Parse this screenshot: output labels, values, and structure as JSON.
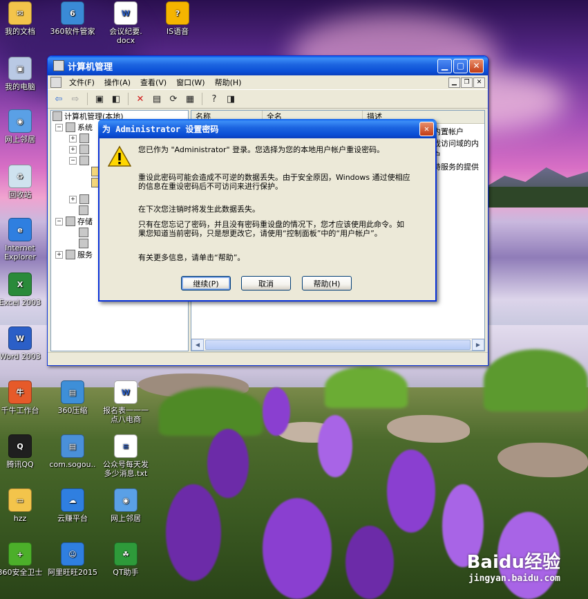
{
  "desktop": {
    "icons": [
      {
        "label": "我的文档",
        "label2": "",
        "color": "#f3c44b",
        "glyph": "✉"
      },
      {
        "label": "360软件管家",
        "label2": "",
        "color": "#3a8ad6",
        "glyph": "6"
      },
      {
        "label": "会议纪要.",
        "label2": "docx",
        "color": "#ffffff",
        "glyph": "W"
      },
      {
        "label": "IS语音",
        "label2": "",
        "color": "#f5b400",
        "glyph": "?"
      },
      {
        "label": "我的电脑",
        "label2": "",
        "color": "#b9c9e4",
        "glyph": "▣"
      },
      {
        "label": "网上邻居",
        "label2": "",
        "color": "#5aa0e6",
        "glyph": "◉"
      },
      {
        "label": "回收站",
        "label2": "",
        "color": "#cfe3ef",
        "glyph": "♻"
      },
      {
        "label": "Internet",
        "label2": "Explorer",
        "color": "#2f7fe0",
        "glyph": "e"
      },
      {
        "label": "Excel 2003",
        "label2": "",
        "color": "#2a8a3a",
        "glyph": "X"
      },
      {
        "label": "Word 2003",
        "label2": "",
        "color": "#2b5fc7",
        "glyph": "W"
      },
      {
        "label": "千牛工作台",
        "label2": "",
        "color": "#e65a2a",
        "glyph": "牛"
      },
      {
        "label": "360压缩",
        "label2": "",
        "color": "#3e8fd8",
        "glyph": "▤"
      },
      {
        "label": "报名表一一一",
        "label2": "点八电商",
        "color": "#ffffff",
        "glyph": "W"
      },
      {
        "label": "腾讯QQ",
        "label2": "",
        "color": "#1f1f1f",
        "glyph": "Q"
      },
      {
        "label": "com.sogou..",
        "label2": "",
        "color": "#4a90d9",
        "glyph": "▤"
      },
      {
        "label": "公众号每天发",
        "label2": "多少消息.txt",
        "color": "#ffffff",
        "glyph": "≡"
      },
      {
        "label": "hzz",
        "label2": "",
        "color": "#f3c44b",
        "glyph": "▭"
      },
      {
        "label": "云赚平台",
        "label2": "",
        "color": "#2f7fe0",
        "glyph": "☁"
      },
      {
        "label": "网上邻居",
        "label2": "",
        "color": "#5aa0e6",
        "glyph": "◉"
      },
      {
        "label": "360安全卫士",
        "label2": "",
        "color": "#4caf2a",
        "glyph": "+"
      },
      {
        "label": "阿里旺旺2015",
        "label2": "",
        "color": "#2f7fe0",
        "glyph": "☺"
      },
      {
        "label": "QT助手",
        "label2": "",
        "color": "#2e9a3a",
        "glyph": "☘"
      }
    ]
  },
  "mmc": {
    "title": "计算机管理",
    "menu": [
      "文件(F)",
      "操作(A)",
      "查看(V)",
      "窗口(W)",
      "帮助(H)"
    ],
    "tree": {
      "root": "计算机管理(本地)",
      "system": "系统",
      "storage": "存储",
      "services": "服务"
    },
    "columns": [
      "名称",
      "全名",
      "描述"
    ],
    "desc_rows": [
      "内置帐户",
      "戏访问域的内",
      "户",
      "持服务的提供"
    ]
  },
  "dialog": {
    "title": "为 Administrator 设置密码",
    "line1": "您已作为 \"Administrator\" 登录。您选择为您的本地用户帐户重设密码。",
    "line2a": "重设此密码可能会造成不可逆的数据丢失。由于安全原因，Windows 通过使相应",
    "line2b": "的信息在重设密码后不可访问来进行保护。",
    "line3": "在下次您注销时将发生此数据丢失。",
    "line4a": "只有在您忘记了密码，并且没有密码重设盘的情况下，您才应该使用此命令。如",
    "line4b": "果您知道当前密码，只是想更改它，请使用“控制面板”中的“用户帐户”。",
    "line5": "有关更多信息，请单击“帮助”。",
    "buttons": {
      "continue": "继续(P)",
      "cancel": "取消",
      "help": "帮助(H)"
    }
  },
  "watermark": {
    "brand": "Baidu经验",
    "url": "jingyan.baidu.com"
  }
}
